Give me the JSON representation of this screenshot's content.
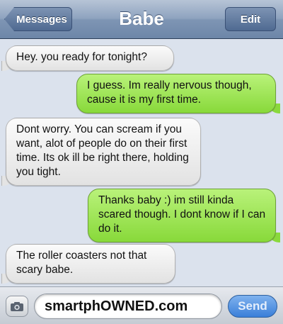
{
  "header": {
    "back_label": "Messages",
    "title": "Babe",
    "edit_label": "Edit"
  },
  "messages": [
    {
      "direction": "incoming",
      "text": "Hey. you ready for tonight?"
    },
    {
      "direction": "outgoing",
      "text": "I guess. Im really nervous though, cause it is my first time."
    },
    {
      "direction": "incoming",
      "text": "Dont worry. You can scream if you want, alot of people do on their first time. Its ok ill be right there, holding you tight."
    },
    {
      "direction": "outgoing",
      "text": "Thanks baby :) im still kinda scared though. I dont know if I can do it."
    },
    {
      "direction": "incoming",
      "text": "The roller coasters not that scary babe."
    }
  ],
  "composer": {
    "icon": "camera-icon",
    "input_value": "smartphOWNED.com",
    "send_label": "Send"
  },
  "colors": {
    "incoming_bubble": "#e8e8e8",
    "outgoing_bubble": "#9fe35c",
    "send_button": "#3a7fd9"
  }
}
